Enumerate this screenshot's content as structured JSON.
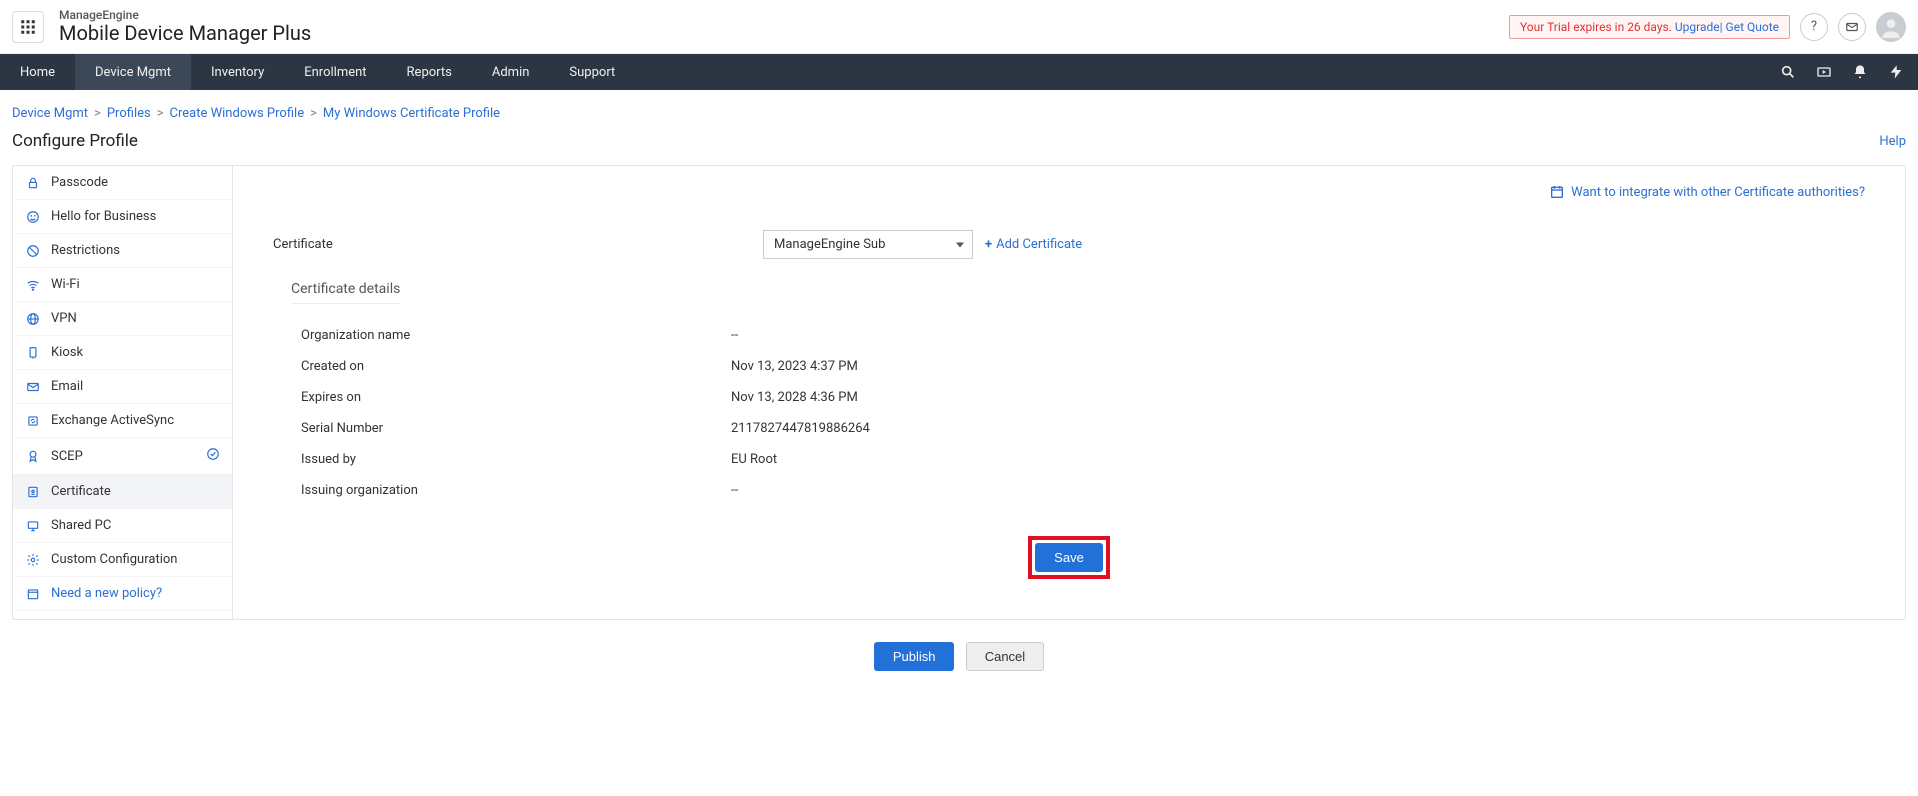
{
  "brand": {
    "top": "ManageEngine",
    "bottom": "Mobile Device Manager Plus"
  },
  "trial": {
    "text": "Your Trial expires in 26 days.",
    "upgrade": "Upgrade",
    "quote": "Get Quote"
  },
  "nav": {
    "items": [
      "Home",
      "Device Mgmt",
      "Inventory",
      "Enrollment",
      "Reports",
      "Admin",
      "Support"
    ],
    "active": 1
  },
  "breadcrumbs": [
    "Device Mgmt",
    "Profiles",
    "Create Windows Profile",
    "My Windows Certificate Profile"
  ],
  "page": {
    "title": "Configure Profile",
    "help": "Help"
  },
  "sidebar": {
    "items": [
      {
        "label": "Passcode",
        "icon": "lock"
      },
      {
        "label": "Hello for Business",
        "icon": "smile"
      },
      {
        "label": "Restrictions",
        "icon": "deny"
      },
      {
        "label": "Wi-Fi",
        "icon": "wifi"
      },
      {
        "label": "VPN",
        "icon": "globe"
      },
      {
        "label": "Kiosk",
        "icon": "kiosk"
      },
      {
        "label": "Email",
        "icon": "mail"
      },
      {
        "label": "Exchange ActiveSync",
        "icon": "sync"
      },
      {
        "label": "SCEP",
        "icon": "badge",
        "checked": true
      },
      {
        "label": "Certificate",
        "icon": "cert",
        "active": true
      },
      {
        "label": "Shared PC",
        "icon": "shared"
      },
      {
        "label": "Custom Configuration",
        "icon": "gear"
      }
    ],
    "need": "Need a new policy?"
  },
  "form": {
    "integrate": "Want to integrate with other Certificate authorities?",
    "certificate_label": "Certificate",
    "certificate_value": "ManageEngine Sub",
    "add_certificate": "Add Certificate",
    "details_title": "Certificate details",
    "details": [
      {
        "label": "Organization name",
        "value": "--"
      },
      {
        "label": "Created on",
        "value": "Nov 13, 2023 4:37 PM"
      },
      {
        "label": "Expires on",
        "value": "Nov 13, 2028 4:36 PM"
      },
      {
        "label": "Serial Number",
        "value": "2117827447819886264"
      },
      {
        "label": "Issued by",
        "value": "EU Root"
      },
      {
        "label": "Issuing organization",
        "value": "--"
      }
    ],
    "save": "Save"
  },
  "footer": {
    "publish": "Publish",
    "cancel": "Cancel"
  }
}
